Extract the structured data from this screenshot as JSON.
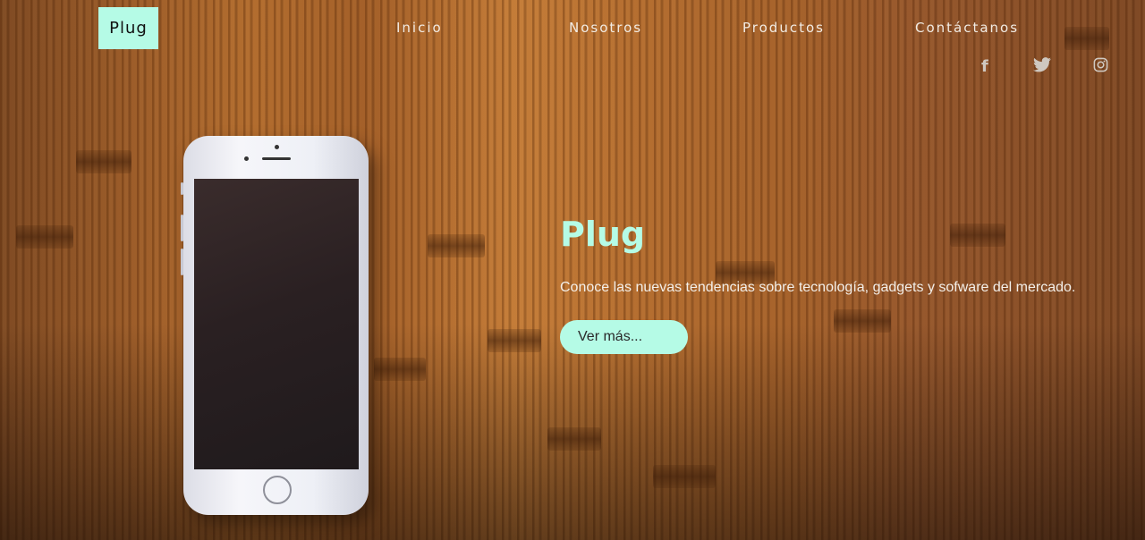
{
  "header": {
    "logo": "Plug",
    "nav": [
      "Inicio",
      "Nosotros",
      "Productos",
      "Contáctanos"
    ],
    "social": [
      {
        "icon": "facebook-icon",
        "glyph": "f"
      },
      {
        "icon": "twitter-icon",
        "glyph": "🐦"
      },
      {
        "icon": "instagram-icon",
        "glyph": "◎"
      }
    ]
  },
  "hero": {
    "title": "Plug",
    "subtitle": "Conoce las nuevas tendencias sobre tecnología, gadgets y sofware del mercado.",
    "button": "Ver más..."
  },
  "colors": {
    "accent": "#b5fbe6",
    "wood": "#a05c26"
  }
}
